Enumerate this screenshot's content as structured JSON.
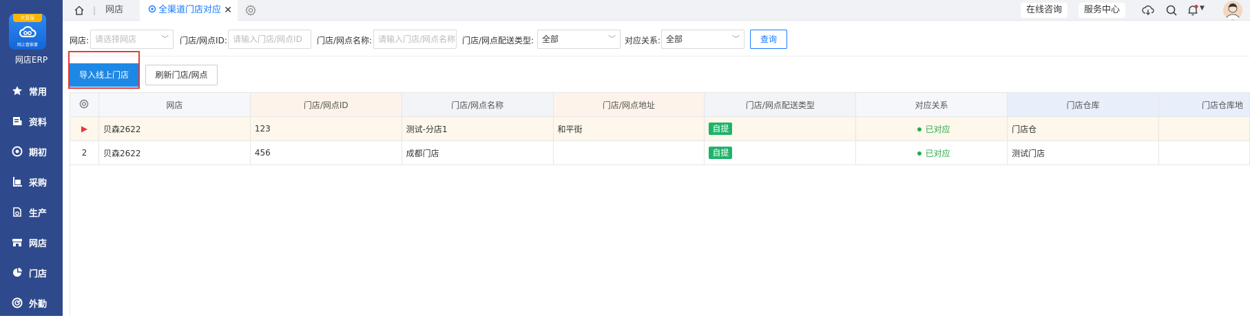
{
  "app": {
    "name": "网店ERP",
    "logo_ribbon": "大管家",
    "logo_sub": "网上管家婆"
  },
  "sidebar": {
    "items": [
      {
        "label": "常用",
        "icon": "star-icon"
      },
      {
        "label": "资料",
        "icon": "document-icon"
      },
      {
        "label": "期初",
        "icon": "target-icon"
      },
      {
        "label": "采购",
        "icon": "purchase-icon"
      },
      {
        "label": "生产",
        "icon": "production-icon"
      },
      {
        "label": "网店",
        "icon": "store-icon"
      },
      {
        "label": "门店",
        "icon": "pie-icon"
      },
      {
        "label": "外勤",
        "icon": "field-icon"
      }
    ]
  },
  "tabs": {
    "home_icon": "home-icon",
    "items": [
      {
        "label": "网店"
      },
      {
        "label": "全渠道门店对应",
        "active": true
      }
    ],
    "close": "✕"
  },
  "topbar": {
    "consult": "在线咨询",
    "service": "服务中心"
  },
  "filters": {
    "shop_label": "网店:",
    "shop_placeholder": "请选择网店",
    "id_label": "门店/网点ID:",
    "id_placeholder": "请输入门店/网点ID",
    "name_label": "门店/网点名称:",
    "name_placeholder": "请输入门店/网点名称",
    "delivery_label": "门店/网点配送类型:",
    "delivery_value": "全部",
    "relation_label": "对应关系:",
    "relation_value": "全部",
    "query": "查询"
  },
  "actions": {
    "import": "导入线上门店",
    "refresh": "刷新门店/网点"
  },
  "table": {
    "headers": [
      "网店",
      "门店/网点ID",
      "门店/网点名称",
      "门店/网点地址",
      "门店/网点配送类型",
      "对应关系",
      "门店仓库",
      "门店仓库地"
    ],
    "rows": [
      {
        "idx": "▶",
        "shop": "贝森2622",
        "id": "123",
        "name": "测试-分店1",
        "address": "和平街",
        "delivery": "自提",
        "relation": "已对应",
        "warehouse": "门店仓",
        "warehouse_addr": ""
      },
      {
        "idx": "2",
        "shop": "贝森2622",
        "id": "456",
        "name": "成都门店",
        "address": "",
        "delivery": "自提",
        "relation": "已对应",
        "warehouse": "测试门店",
        "warehouse_addr": ""
      }
    ]
  },
  "colors": {
    "sidebar": "#2e4a8c",
    "primary": "#1677ff",
    "highlight": "#e53935",
    "tag": "#1fb36a",
    "matched": "#2ba84a"
  }
}
